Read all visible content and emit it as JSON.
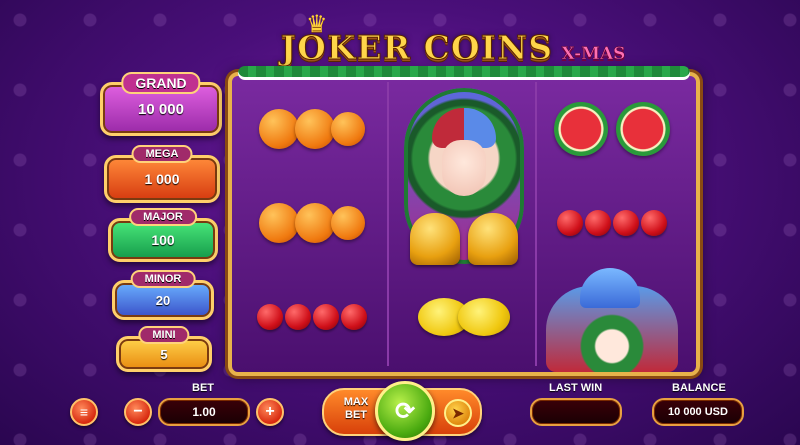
{
  "title": {
    "main": "JOKER COINS",
    "sub": "X-MAS"
  },
  "jackpots": [
    {
      "id": "grand",
      "label": "GRAND",
      "value": "10 000"
    },
    {
      "id": "mega",
      "label": "MEGA",
      "value": "1 000"
    },
    {
      "id": "major",
      "label": "MAJOR",
      "value": "100"
    },
    {
      "id": "minor",
      "label": "MINOR",
      "value": "20"
    },
    {
      "id": "mini",
      "label": "MINI",
      "value": "5"
    }
  ],
  "reels": [
    [
      "orange",
      "orange",
      "cherry"
    ],
    [
      "joker",
      "bell",
      "lemon"
    ],
    [
      "watermelon",
      "cherry",
      "joker"
    ]
  ],
  "controls": {
    "bet_label": "BET",
    "bet_value": "1.00",
    "minus": "−",
    "plus": "+",
    "menu": "≡",
    "max_bet": "MAX BET",
    "last_win_label": "LAST WIN",
    "last_win_value": "",
    "balance_label": "BALANCE",
    "balance_value": "10 000 USD"
  },
  "colors": {
    "accent_gold": "#ffd54a",
    "frame": "#e8b24a",
    "spin": "#4aaa10"
  }
}
